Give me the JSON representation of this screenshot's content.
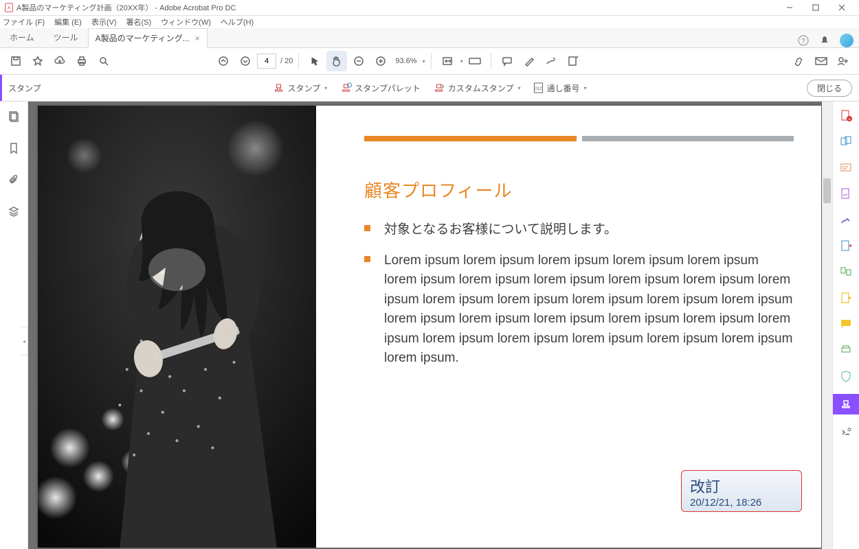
{
  "window": {
    "title": "A製品のマーケティング計画（20XX年）   - Adobe Acrobat Pro DC"
  },
  "menu": {
    "file": "ファイル (F)",
    "edit": "編集 (E)",
    "view": "表示(V)",
    "sign": "署名(S)",
    "window": "ウィンドウ(W)",
    "help": "ヘルプ(H)"
  },
  "tabs": {
    "home": "ホーム",
    "tools": "ツール",
    "doc": "A製品のマーケティング..."
  },
  "toolbar": {
    "page_current": "4",
    "page_total": "/ 20",
    "zoom": "93.6%"
  },
  "stampbar": {
    "label": "スタンプ",
    "stamp": "スタンプ",
    "palette": "スタンプパレット",
    "custom": "カスタムスタンプ",
    "bates": "通し番号",
    "close": "閉じる"
  },
  "doc": {
    "heading": "顧客プロフィール",
    "bullets": [
      "対象となるお客様について説明します。",
      "Lorem ipsum lorem ipsum lorem ipsum lorem ipsum lorem ipsum lorem ipsum lorem ipsum lorem ipsum lorem ipsum lorem ipsum lorem ipsum lorem ipsum lorem ipsum lorem ipsum lorem ipsum lorem ipsum lorem ipsum lorem ipsum lorem ipsum lorem ipsum lorem ipsum lorem ipsum lorem ipsum lorem ipsum lorem ipsum lorem ipsum lorem ipsum lorem ipsum."
    ],
    "stamp": {
      "title": "改訂",
      "datetime": "20/12/21, 18:26"
    }
  }
}
